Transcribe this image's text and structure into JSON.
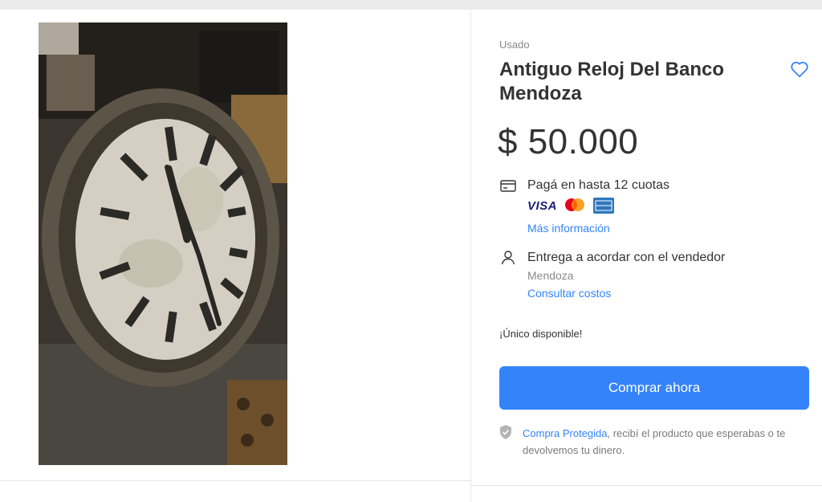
{
  "product": {
    "condition": "Usado",
    "title": "Antiguo Reloj Del Banco Mendoza",
    "price": "$ 50.000",
    "image_alt": "antique wall clock photo"
  },
  "payment": {
    "cuotas_text": "Pagá en hasta 12 cuotas",
    "brands": [
      "VISA",
      "mastercard",
      "amex"
    ],
    "more_info": "Más información"
  },
  "shipping": {
    "text": "Entrega a acordar con el vendedor",
    "location": "Mendoza",
    "costs_link": "Consultar costos"
  },
  "stock": "¡Único disponible!",
  "buy": {
    "label": "Comprar ahora",
    "color": "#3483fa"
  },
  "protection": {
    "link": "Compra Protegida",
    "text": ", recibí el producto que esperabas o te devolvemos tu dinero."
  },
  "icons": {
    "favorite": "heart-outline-icon",
    "card": "credit-card-icon",
    "user": "person-icon",
    "shield": "shield-check-icon"
  }
}
